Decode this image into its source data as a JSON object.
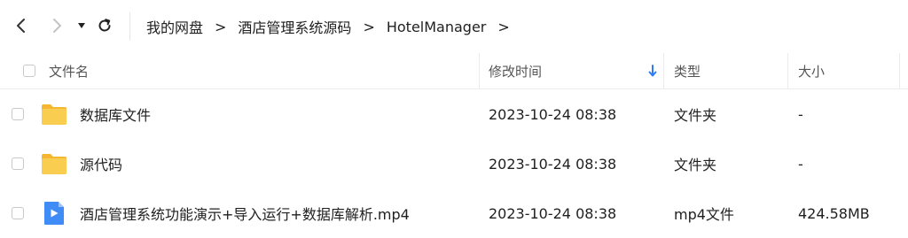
{
  "nav": {
    "back_icon": "chevron-left-icon",
    "forward_icon": "chevron-right-icon",
    "history_icon": "caret-down-icon",
    "refresh_icon": "refresh-icon"
  },
  "breadcrumb": {
    "items": [
      "我的网盘",
      "酒店管理系统源码",
      "HotelManager"
    ],
    "separator": ">"
  },
  "table": {
    "headers": {
      "name": "文件名",
      "modified": "修改时间",
      "type": "类型",
      "size": "大小"
    },
    "sort_icon": "sort-down-arrow-icon",
    "rows": [
      {
        "name": "数据库文件",
        "modified": "2023-10-24 08:38",
        "type": "文件夹",
        "size": "-",
        "icon": "folder-icon"
      },
      {
        "name": "源代码",
        "modified": "2023-10-24 08:38",
        "type": "文件夹",
        "size": "-",
        "icon": "folder-icon"
      },
      {
        "name": "酒店管理系统功能演示+导入运行+数据库解析.mp4",
        "modified": "2023-10-24 08:38",
        "type": "mp4文件",
        "size": "424.58MB",
        "icon": "video-file-icon"
      }
    ]
  },
  "colors": {
    "accent": "#2f7cf6",
    "folder": "#f7c143",
    "video": "#3f8cf7"
  }
}
